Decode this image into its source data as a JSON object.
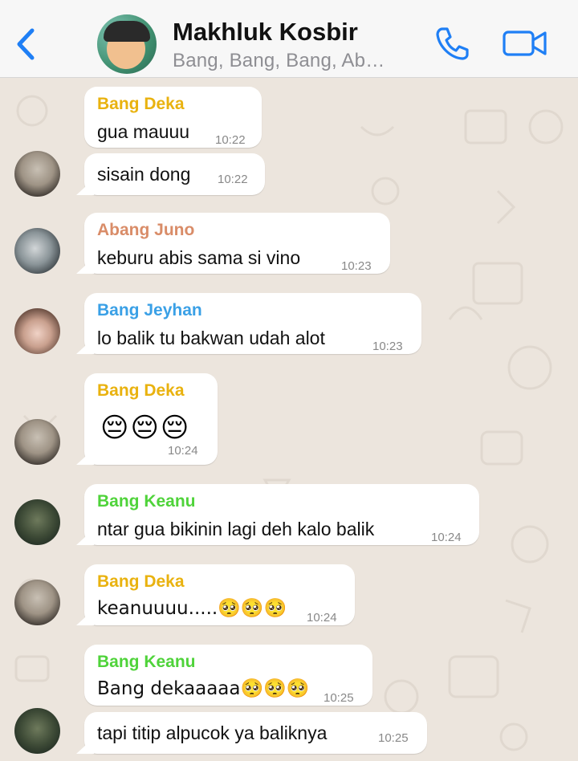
{
  "header": {
    "title": "Makhluk Kosbir",
    "subtitle": "Bang, Bang, Bang, Ab…"
  },
  "colors": {
    "accent": "#1f7ff5",
    "bang_deka": "#e9b20f",
    "abang_juno": "#d98c68",
    "bang_jeyhan": "#3aa0e6",
    "bang_keanu": "#4fd33a"
  },
  "messages": [
    {
      "sender": "Bang Deka",
      "text": "gua mauuu",
      "time": "10:22"
    },
    {
      "sender": "",
      "text": "sisain dong",
      "time": "10:22"
    },
    {
      "sender": "Abang Juno",
      "text": "keburu abis sama si vino",
      "time": "10:23"
    },
    {
      "sender": "Bang Jeyhan",
      "text": "lo balik tu bakwan udah alot",
      "time": "10:23"
    },
    {
      "sender": "Bang Deka",
      "text": "😔😔😔",
      "time": "10:24"
    },
    {
      "sender": "Bang Keanu",
      "text": "ntar gua bikinin lagi deh kalo balik",
      "time": "10:24"
    },
    {
      "sender": "Bang Deka",
      "text": "keanuuuu.....🥺🥺🥺",
      "time": "10:24"
    },
    {
      "sender": "Bang Keanu",
      "text": "Bang dekaaaaa🥺🥺🥺",
      "time": "10:25"
    },
    {
      "sender": "",
      "text": "tapi titip alpucok ya baliknya",
      "time": "10:25"
    }
  ],
  "icons": {
    "back": "chevron-left-icon",
    "call": "phone-icon",
    "video": "video-camera-icon"
  }
}
